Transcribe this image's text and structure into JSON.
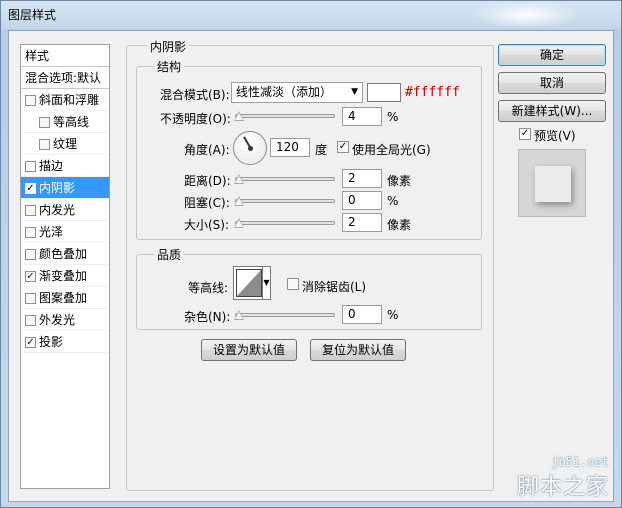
{
  "window": {
    "title": "图层样式"
  },
  "styles_panel": {
    "header": "样式",
    "blend_options": "混合选项:默认",
    "items": [
      {
        "label": "斜面和浮雕",
        "checked": false,
        "indent": false,
        "selected": false
      },
      {
        "label": "等高线",
        "checked": false,
        "indent": true,
        "selected": false
      },
      {
        "label": "纹理",
        "checked": false,
        "indent": true,
        "selected": false
      },
      {
        "label": "描边",
        "checked": false,
        "indent": false,
        "selected": false
      },
      {
        "label": "内阴影",
        "checked": true,
        "indent": false,
        "selected": true
      },
      {
        "label": "内发光",
        "checked": false,
        "indent": false,
        "selected": false
      },
      {
        "label": "光泽",
        "checked": false,
        "indent": false,
        "selected": false
      },
      {
        "label": "颜色叠加",
        "checked": false,
        "indent": false,
        "selected": false
      },
      {
        "label": "渐变叠加",
        "checked": true,
        "indent": false,
        "selected": false
      },
      {
        "label": "图案叠加",
        "checked": false,
        "indent": false,
        "selected": false
      },
      {
        "label": "外发光",
        "checked": false,
        "indent": false,
        "selected": false
      },
      {
        "label": "投影",
        "checked": true,
        "indent": false,
        "selected": false
      }
    ]
  },
  "inner_shadow": {
    "section_title": "内阴影",
    "structure": {
      "title": "结构",
      "blend_mode_label": "混合模式(B):",
      "blend_mode_value": "线性减淡（添加）",
      "color": "#ffffff",
      "color_text": "#ffffff",
      "opacity_label": "不透明度(O):",
      "opacity_value": "4",
      "opacity_unit": "%",
      "opacity_fraction": 0.04,
      "angle_label": "角度(A):",
      "angle_value": "120",
      "angle_unit": "度",
      "global_light_label": "使用全局光(G)",
      "global_light_checked": true,
      "distance_label": "距离(D):",
      "distance_value": "2",
      "distance_unit": "像素",
      "choke_label": "阻塞(C):",
      "choke_value": "0",
      "choke_unit": "%",
      "size_label": "大小(S):",
      "size_value": "2",
      "size_unit": "像素"
    },
    "quality": {
      "title": "品质",
      "contour_label": "等高线:",
      "antialias_label": "消除锯齿(L)",
      "antialias_checked": false,
      "noise_label": "杂色(N):",
      "noise_value": "0",
      "noise_unit": "%"
    },
    "make_default_button": "设置为默认值",
    "reset_default_button": "复位为默认值"
  },
  "actions": {
    "ok": "确定",
    "cancel": "取消",
    "new_style": "新建样式(W)...",
    "preview_label": "预览(V)",
    "preview_checked": true
  },
  "watermark": {
    "url": "jb51.net",
    "name": "脚本之家"
  }
}
